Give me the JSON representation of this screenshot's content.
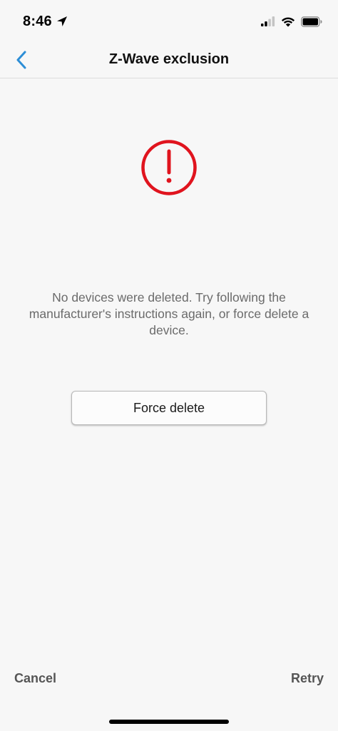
{
  "status_bar": {
    "time": "8:46",
    "location_icon": "location-arrow-icon",
    "signal_icon": "cellular-signal-icon",
    "wifi_icon": "wifi-icon",
    "battery_icon": "battery-icon"
  },
  "nav": {
    "back_icon": "chevron-left-icon",
    "title": "Z-Wave exclusion"
  },
  "content": {
    "alert_icon": "exclamation-circle-icon",
    "message": "No devices were deleted. Try following the manufacturer's instructions again, or force delete a device.",
    "force_delete_label": "Force delete"
  },
  "footer": {
    "cancel_label": "Cancel",
    "retry_label": "Retry"
  },
  "colors": {
    "accent": "#2d8ed6",
    "error": "#e0141e",
    "background": "#f7f7f7",
    "secondary_text": "#6b6b6b"
  }
}
